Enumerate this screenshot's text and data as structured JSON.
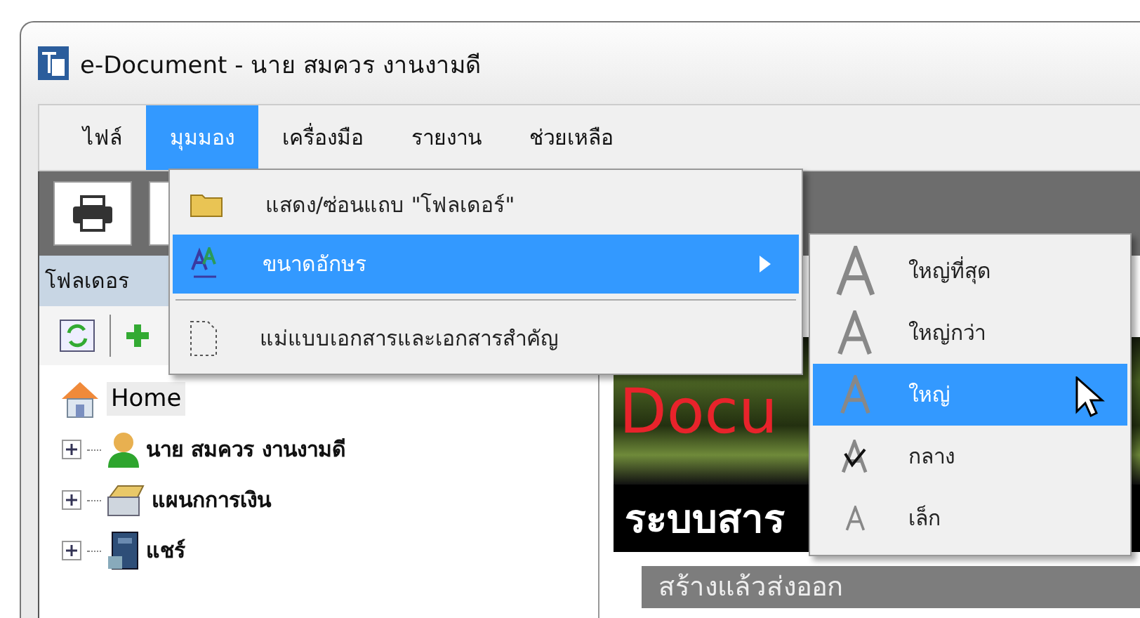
{
  "window": {
    "title": "e-Document - นาย สมควร งานงามดี"
  },
  "menu_bar": [
    {
      "label": "ไฟล์",
      "selected": false
    },
    {
      "label": "มุมมอง",
      "selected": true
    },
    {
      "label": "เครื่องมือ",
      "selected": false
    },
    {
      "label": "รายงาน",
      "selected": false
    },
    {
      "label": "ช่วยเหลือ",
      "selected": false
    }
  ],
  "view_menu": {
    "items": [
      {
        "kind": "folder",
        "label": "แสดง/ซ่อนแถบ \"โฟลเดอร์\"",
        "selected": false
      },
      {
        "kind": "font",
        "label": "ขนาดอักษร",
        "selected": true
      },
      {
        "kind": "template",
        "label": "แม่แบบเอกสารและเอกสารสำคัญ",
        "selected": false
      }
    ]
  },
  "font_size_menu": {
    "items": [
      {
        "label": "ใหญ่ที่สุด",
        "selected": false,
        "checked": false
      },
      {
        "label": "ใหญ่กว่า",
        "selected": false,
        "checked": false
      },
      {
        "label": "ใหญ่",
        "selected": true,
        "checked": false
      },
      {
        "label": "กลาง",
        "selected": false,
        "checked": true
      },
      {
        "label": "เล็ก",
        "selected": false,
        "checked": false
      }
    ]
  },
  "folder_panel": {
    "header": "โฟลเดอร",
    "tree": [
      {
        "label": "Home",
        "selected": true,
        "children": [
          {
            "kind": "user",
            "label": "นาย สมควร งานงามดี",
            "expanded": false
          },
          {
            "kind": "cabinet",
            "label": "แผนกการเงิน",
            "expanded": false
          },
          {
            "kind": "share",
            "label": "แชร์",
            "expanded": false
          }
        ]
      }
    ]
  },
  "banner": {
    "logo_text": "Docu",
    "caption": "ระบบสาร"
  },
  "section": {
    "title": "สร้างแล้วส่งออก"
  }
}
